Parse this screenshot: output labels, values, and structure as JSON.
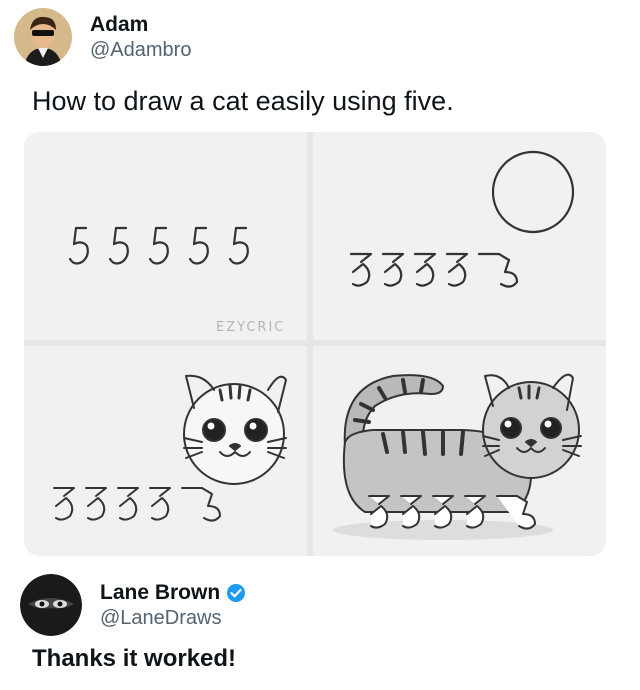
{
  "tweet": {
    "author": {
      "display_name": "Adam",
      "handle": "@Adambro"
    },
    "text": "How to draw a cat easily using five.",
    "image": {
      "panels": [
        {
          "step": 1,
          "label": "55555",
          "watermark": "EZYCRIC"
        },
        {
          "step": 2,
          "label": "five 5s with circle"
        },
        {
          "step": 3,
          "label": "cat head"
        },
        {
          "step": 4,
          "label": "finished cat"
        }
      ]
    }
  },
  "reply": {
    "author": {
      "display_name": "Lane Brown",
      "handle": "@LaneDraws",
      "verified": true
    },
    "text": "Thanks it worked!"
  },
  "colors": {
    "verified_badge": "#1d9bf0",
    "handle_gray": "#536471"
  }
}
